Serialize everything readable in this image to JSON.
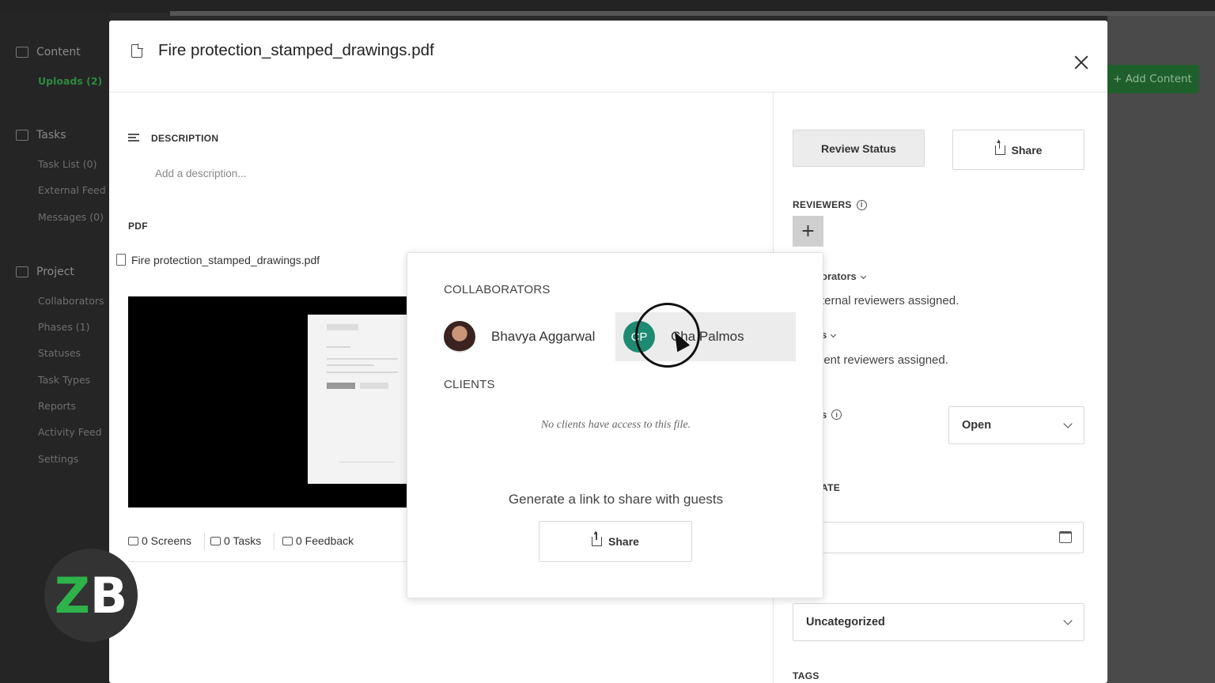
{
  "modal": {
    "title": "Fire protection_stamped_drawings.pdf",
    "description_label": "DESCRIPTION",
    "description_placeholder": "Add a description...",
    "pdf_label": "PDF",
    "pdf_filename": "Fire protection_stamped_drawings.pdf",
    "stats": {
      "screens": "0 Screens",
      "tasks": "0 Tasks",
      "feedback": "0 Feedback"
    }
  },
  "side_panel": {
    "review_status_label": "Review Status",
    "share_label": "Share",
    "reviewers_label": "REVIEWERS",
    "add_reviewer": "+",
    "collaborators_toggle": "orators",
    "no_internal": "ternal reviewers assigned.",
    "clients_toggle": "s",
    "no_client": "ient reviewers assigned.",
    "status_label": "s",
    "status_value": "Open",
    "due_date_label": "ATE",
    "category_value": "Uncategorized",
    "tags_label": "TAGS"
  },
  "popover": {
    "collaborators_label": "COLLABORATORS",
    "collaborators": [
      {
        "name": "Bhavya Aggarwal"
      },
      {
        "name": "Cha Palmos",
        "initials": "CP"
      }
    ],
    "clients_label": "CLIENTS",
    "no_clients": "No clients have access to this file.",
    "guest_link_text": "Generate a link to share with guests",
    "share_button": "Share"
  },
  "background": {
    "sidebar": {
      "content": "Content",
      "uploads": "Uploads (2)",
      "tasks": "Tasks",
      "task_list": "Task List (0)",
      "external_feed": "External Feed",
      "messages": "Messages (0)",
      "project": "Project",
      "collaborators": "Collaborators",
      "phases": "Phases (1)",
      "statuses": "Statuses",
      "task_types": "Task Types",
      "reports": "Reports",
      "activity_feed": "Activity Feed",
      "settings": "Settings"
    },
    "add_content": "+ Add Content"
  },
  "watermark": {
    "z": "Z",
    "b": "B"
  },
  "colors": {
    "accent_green": "#2d8a3e",
    "avatar_teal": "#1f8a72"
  }
}
